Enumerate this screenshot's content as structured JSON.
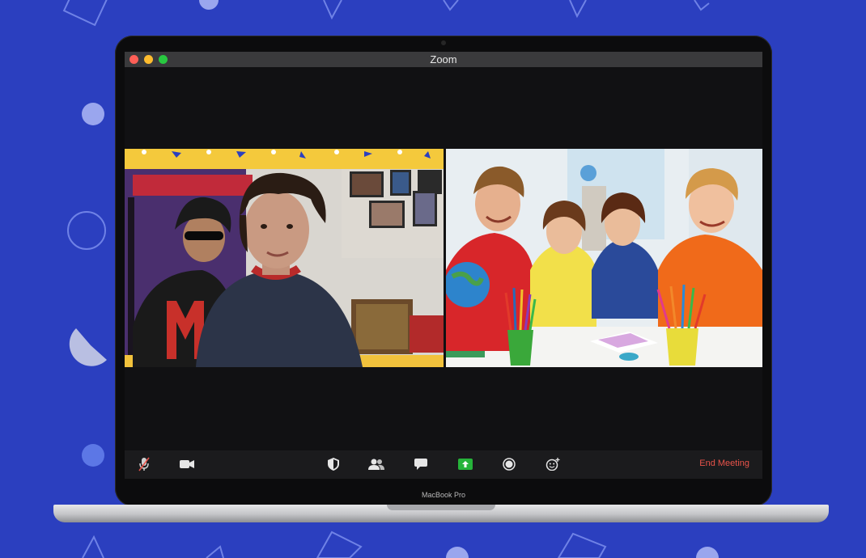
{
  "window": {
    "title": "Zoom"
  },
  "device": {
    "label": "MacBook Pro"
  },
  "participants": [
    {
      "name": "",
      "description": "teen boy in navy sweater in front of poster wall"
    },
    {
      "name": "",
      "description": "four smiling children at classroom table with pencils"
    }
  ],
  "toolbar": {
    "buttons": [
      {
        "icon": "microphone-muted-icon"
      },
      {
        "icon": "video-camera-icon"
      },
      {
        "icon": "security-shield-icon"
      },
      {
        "icon": "participants-icon"
      },
      {
        "icon": "chat-bubble-icon"
      },
      {
        "icon": "share-screen-icon"
      },
      {
        "icon": "record-icon"
      },
      {
        "icon": "reactions-icon"
      }
    ],
    "end_meeting_label": "End Meeting"
  },
  "colors": {
    "background": "#2b3fbf",
    "end_meeting": "#e9534a",
    "share_screen": "#26b33a",
    "traffic_red": "#fe5f57",
    "traffic_yellow": "#febc2e",
    "traffic_green": "#28c840"
  }
}
